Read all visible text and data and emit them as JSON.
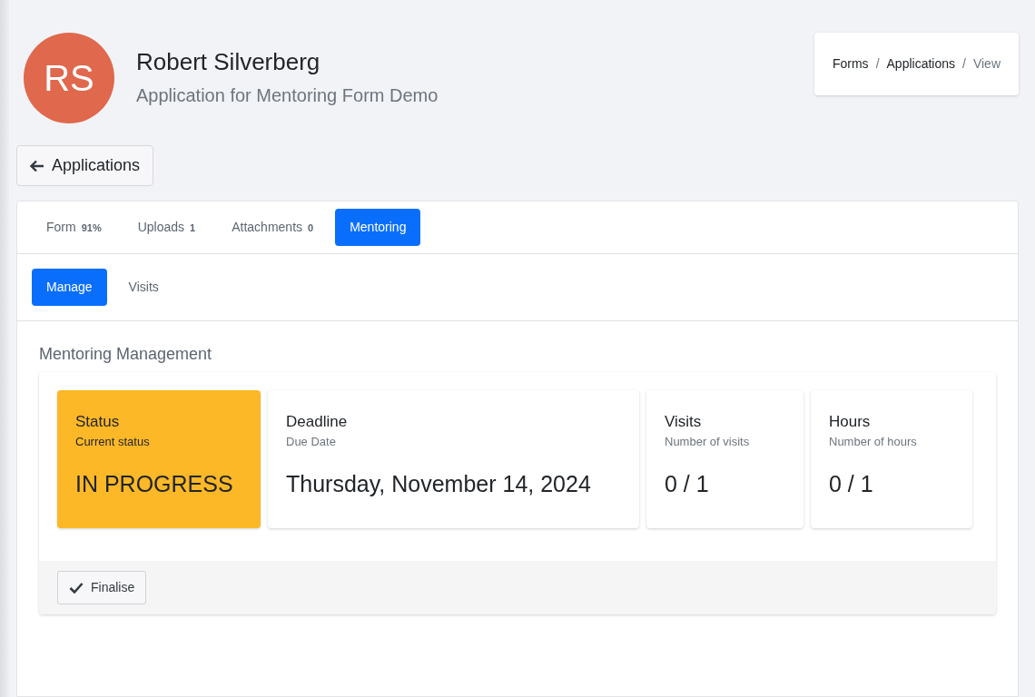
{
  "header": {
    "initials": "RS",
    "name": "Robert Silverberg",
    "subtitle": "Application for Mentoring Form Demo"
  },
  "breadcrumb": [
    {
      "label": "Forms",
      "current": false
    },
    {
      "separator": "/",
      "label": "Applications",
      "current": false
    },
    {
      "separator": "/",
      "label": "View",
      "current": true
    }
  ],
  "back_button": "Applications",
  "tabs": [
    {
      "label": "Form",
      "count": "91%",
      "selected": false
    },
    {
      "label": "Uploads",
      "count": "1",
      "selected": false
    },
    {
      "label": "Attachments",
      "count": "0",
      "selected": false
    },
    {
      "label": "Mentoring",
      "selected": true
    }
  ],
  "subtabs": [
    {
      "label": "Manage",
      "selected": true
    },
    {
      "label": "Visits",
      "selected": false
    }
  ],
  "section_title": "Mentoring Management",
  "tiles": [
    {
      "kind": "status",
      "title": "Status",
      "subtitle": "Current status",
      "value": "IN PROGRESS"
    },
    {
      "kind": "stat",
      "title": "Deadline",
      "subtitle": "Due Date",
      "value": "Thursday, November 14, 2024"
    },
    {
      "kind": "stat",
      "title": "Visits",
      "subtitle": "Number of visits",
      "value": "0 / 1"
    },
    {
      "kind": "stat",
      "title": "Hours",
      "subtitle": "Number of hours",
      "value": "0 / 1"
    }
  ],
  "footer_button": "Finalise"
}
